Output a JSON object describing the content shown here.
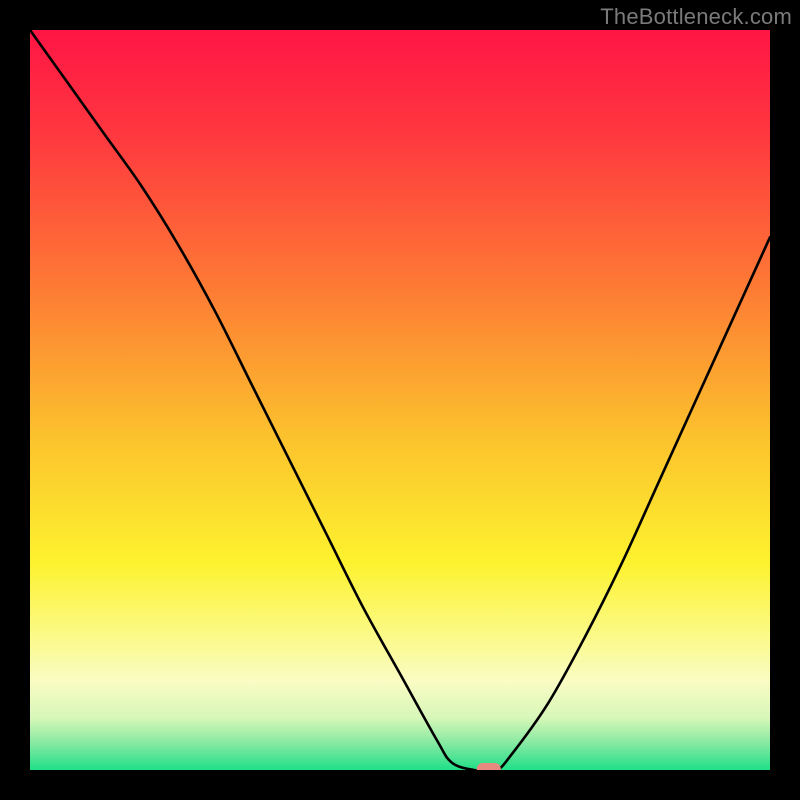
{
  "watermark": "TheBottleneck.com",
  "chart_data": {
    "type": "line",
    "title": "",
    "xlabel": "",
    "ylabel": "",
    "xlim": [
      0,
      100
    ],
    "ylim": [
      0,
      100
    ],
    "x": [
      0,
      5,
      10,
      15,
      20,
      25,
      30,
      35,
      40,
      45,
      50,
      55,
      57,
      60,
      63,
      65,
      70,
      75,
      80,
      85,
      90,
      95,
      100
    ],
    "y": [
      100,
      93,
      86,
      79,
      71,
      62,
      52,
      42,
      32,
      22,
      13,
      4,
      1,
      0,
      0,
      2,
      9,
      18,
      28,
      39,
      50,
      61,
      72
    ],
    "marker": {
      "x": 62,
      "y": 0,
      "color": "#e8897f"
    },
    "gradient_stops": [
      {
        "offset": 0.0,
        "color": "#ff1545"
      },
      {
        "offset": 0.15,
        "color": "#ff3a3f"
      },
      {
        "offset": 0.35,
        "color": "#fd7b34"
      },
      {
        "offset": 0.55,
        "color": "#fcc22d"
      },
      {
        "offset": 0.72,
        "color": "#fdf22e"
      },
      {
        "offset": 0.82,
        "color": "#fbfa89"
      },
      {
        "offset": 0.88,
        "color": "#fafcc4"
      },
      {
        "offset": 0.93,
        "color": "#d6f7b8"
      },
      {
        "offset": 0.965,
        "color": "#83e9a1"
      },
      {
        "offset": 1.0,
        "color": "#1fdf88"
      }
    ]
  }
}
